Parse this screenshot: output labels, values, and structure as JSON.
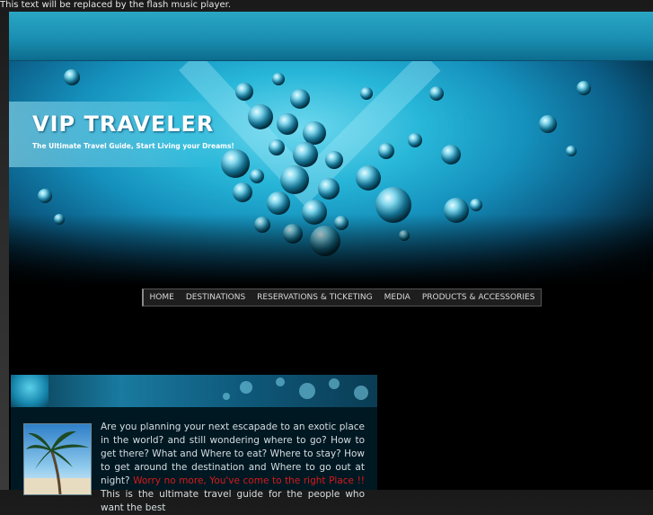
{
  "flash_notice": "This text will be replaced by the flash music player.",
  "header": {
    "site_title": "VIP TRAVELER",
    "tagline": "The Ultimate Travel Guide, Start Living your Dreams!"
  },
  "nav": {
    "items": [
      {
        "label": "HOME"
      },
      {
        "label": "DESTINATIONS"
      },
      {
        "label": "RESERVATIONS & TICKETING"
      },
      {
        "label": "MEDIA"
      },
      {
        "label": "PRODUCTS & ACCESSORIES"
      }
    ]
  },
  "intro": {
    "part1": "Are you planning your next escapade to an exotic place in the world? and still wondering where to go? How to get there? What and Where to eat? Where to stay? How to get around the destination and Where to go out at night?",
    "highlight": "Worry no more, You've come to the right Place !!",
    "part2": "This is the ultimate travel guide for the people who want the best"
  },
  "colors": {
    "accent": "#1a8fb2",
    "highlight": "#d81a1a",
    "nav_bg": "#1e1e1e"
  }
}
